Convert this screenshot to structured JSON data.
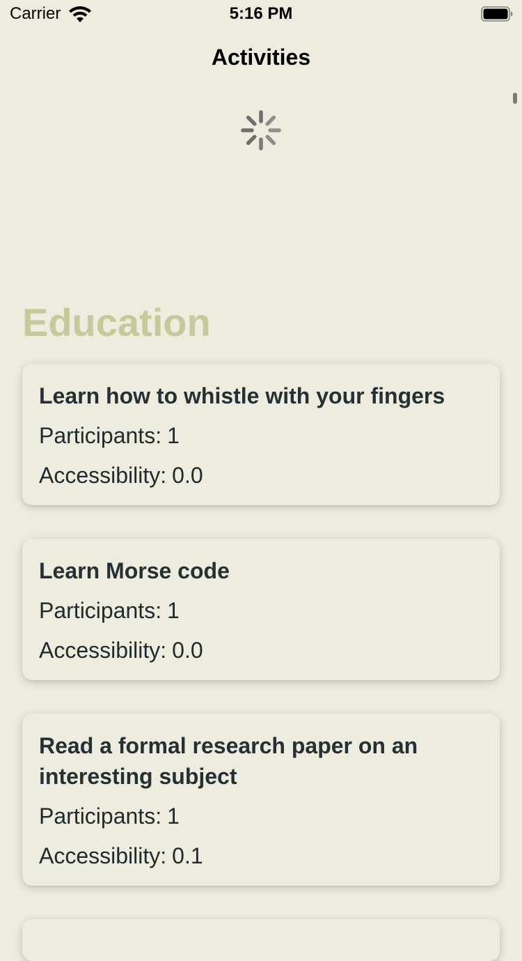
{
  "status_bar": {
    "carrier": "Carrier",
    "time": "5:16 PM",
    "icons": [
      "wifi-icon",
      "battery-icon"
    ]
  },
  "nav": {
    "title": "Activities"
  },
  "loading": {
    "icon": "spinner-icon"
  },
  "section": {
    "title": "Education",
    "color": "#C9C89A"
  },
  "colors": {
    "background": "#EEECDE",
    "card_text": "#243034"
  },
  "activities": [
    {
      "title": "Learn how to whistle with your fingers",
      "participants_label": "Participants:",
      "participants": "1",
      "accessibility_label": "Accessibility:",
      "accessibility": "0.0"
    },
    {
      "title": "Learn Morse code",
      "participants_label": "Participants:",
      "participants": "1",
      "accessibility_label": "Accessibility:",
      "accessibility": "0.0"
    },
    {
      "title": "Read a formal research paper on an interesting subject",
      "participants_label": "Participants:",
      "participants": "1",
      "accessibility_label": "Accessibility:",
      "accessibility": "0.1"
    }
  ]
}
